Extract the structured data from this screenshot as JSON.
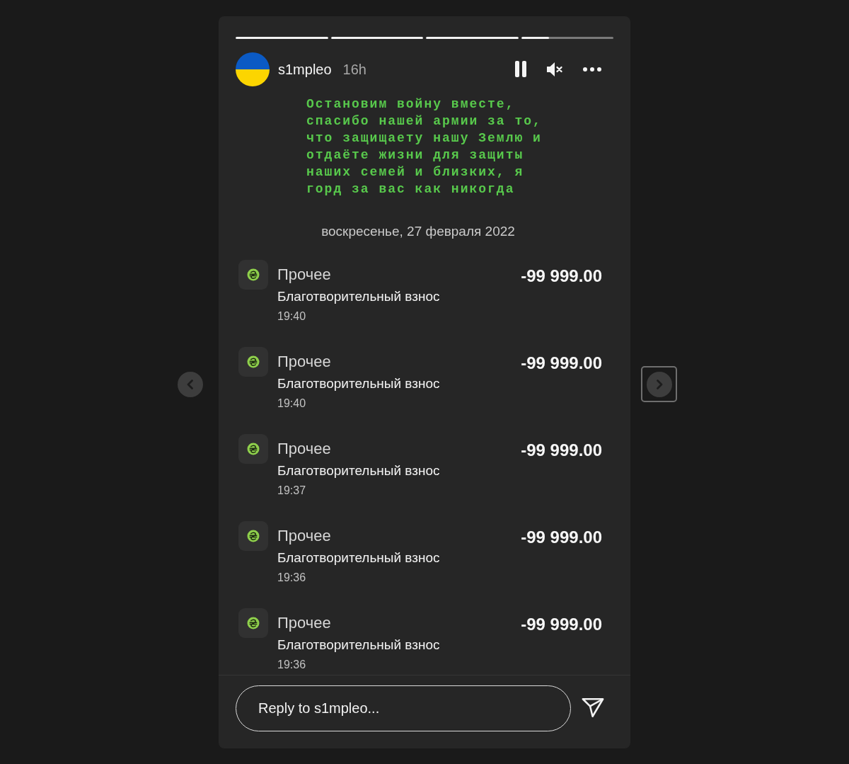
{
  "navigation": {
    "previous": {
      "focused": false
    },
    "next": {
      "focused": true
    }
  },
  "story": {
    "progress": [
      {
        "level": 1
      },
      {
        "level": 1
      },
      {
        "level": 1
      },
      {
        "level": 0.3
      }
    ],
    "header": {
      "username": "s1mpleo",
      "time": "16h",
      "playing": true,
      "muted": true
    },
    "content": {
      "message": "Остановим войну вместе, спасибо нашей армии за то, что защищаету нашу Землю и отдаёте жизни для защиты наших семей и близких, я горд за вас как никогда",
      "date": "воскресенье, 27 февраля 2022",
      "transactions": [
        {
          "category": "Прочее",
          "description": "Благотворительный взнос",
          "time": "19:40",
          "amount": "-99 999.00"
        },
        {
          "category": "Прочее",
          "description": "Благотворительный взнос",
          "time": "19:40",
          "amount": "-99 999.00"
        },
        {
          "category": "Прочее",
          "description": "Благотворительный взнос",
          "time": "19:37",
          "amount": "-99 999.00"
        },
        {
          "category": "Прочее",
          "description": "Благотворительный взнос",
          "time": "19:36",
          "amount": "-99 999.00"
        },
        {
          "category": "Прочее",
          "description": "Благотворительный взнос",
          "time": "19:36",
          "amount": "-99 999.00"
        }
      ]
    },
    "reply": {
      "placeholder": "Reply to s1mpleo..."
    }
  }
}
